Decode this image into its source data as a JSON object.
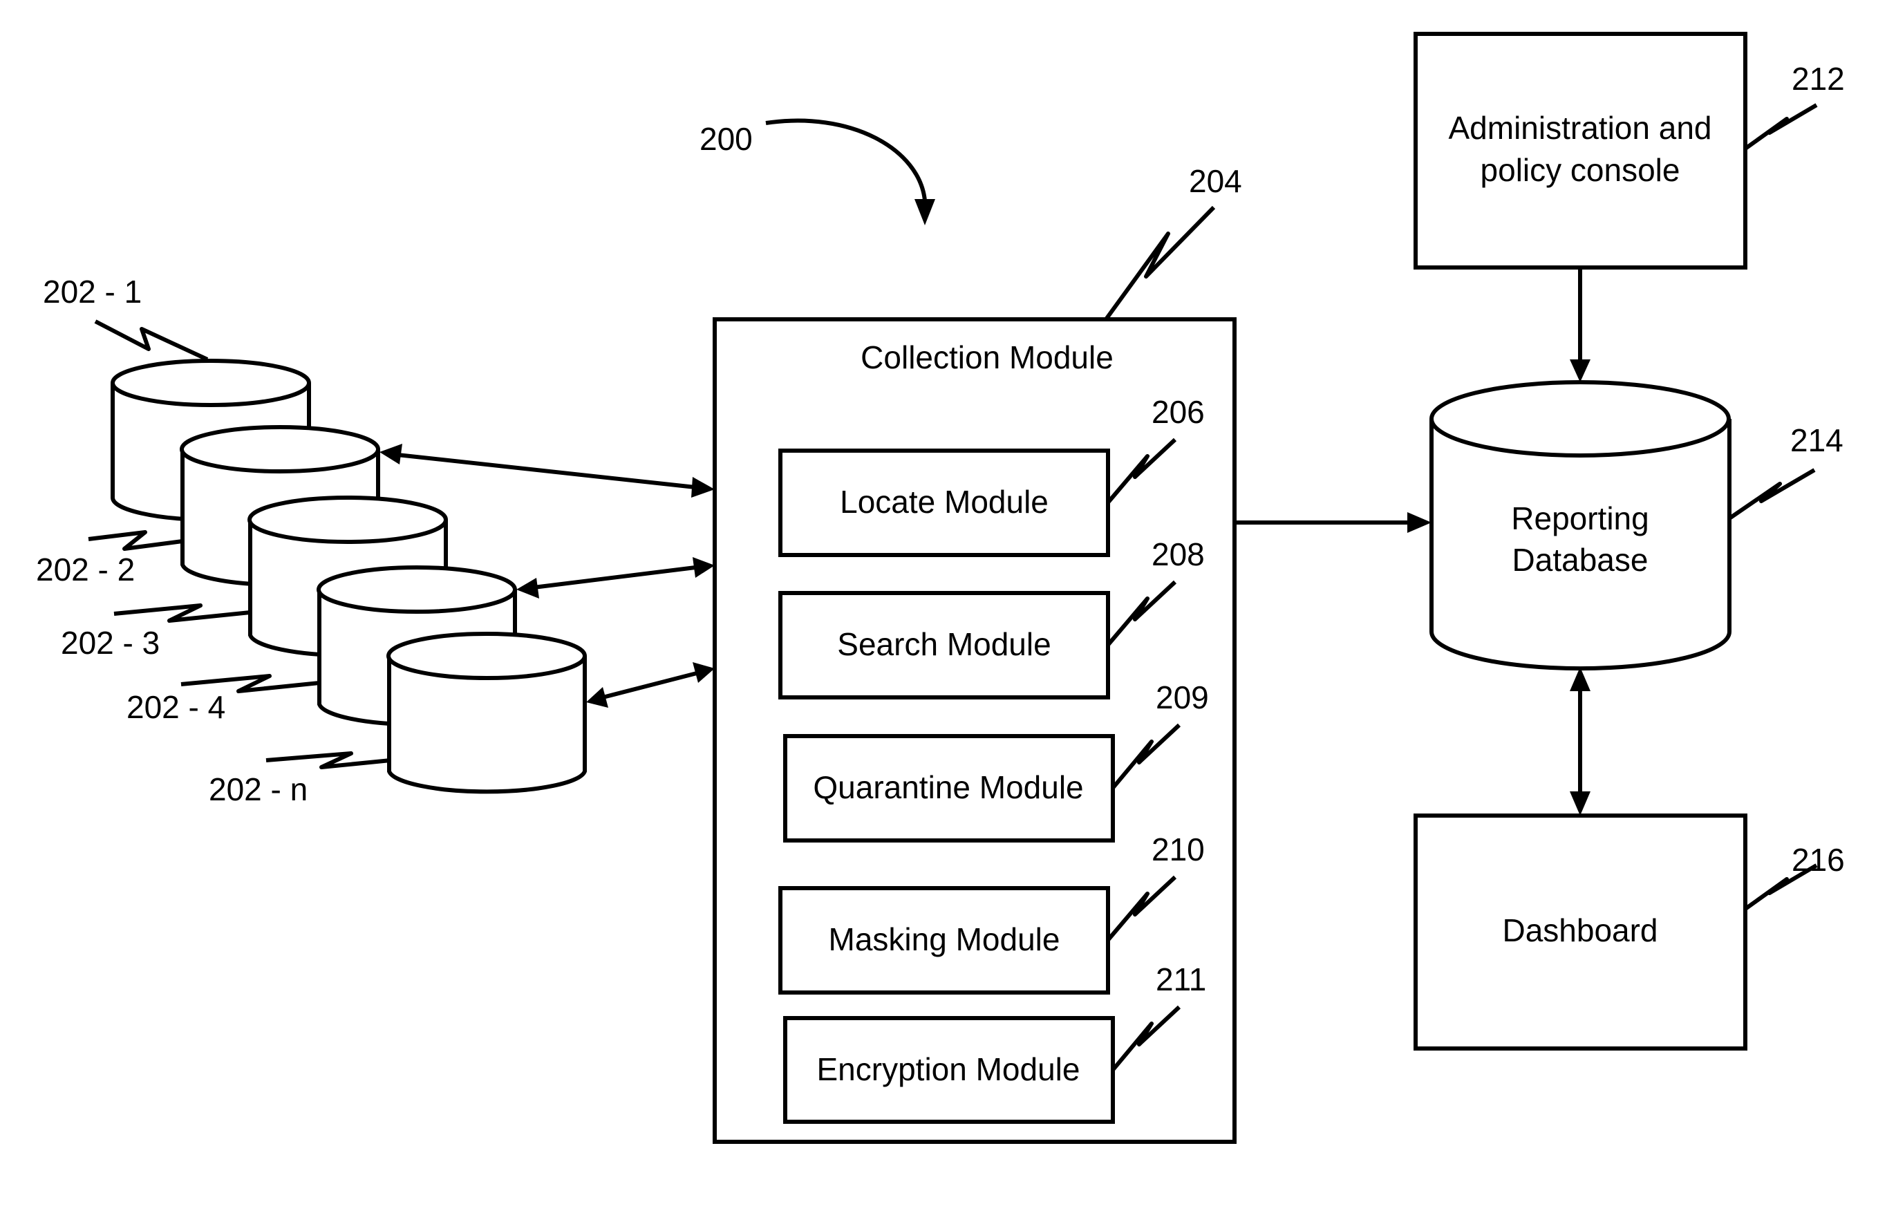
{
  "figure": {
    "reference": "200"
  },
  "data_sources": [
    {
      "ref": "202 - 1"
    },
    {
      "ref": "202 - 2"
    },
    {
      "ref": "202 - 3"
    },
    {
      "ref": "202 - 4"
    },
    {
      "ref": "202 - n"
    }
  ],
  "collection_module": {
    "title": "Collection Module",
    "ref": "204",
    "submodules": [
      {
        "label": "Locate Module",
        "ref": "206"
      },
      {
        "label": "Search Module",
        "ref": "208"
      },
      {
        "label": "Quarantine Module",
        "ref": "209"
      },
      {
        "label": "Masking Module",
        "ref": "210"
      },
      {
        "label": "Encryption Module",
        "ref": "211"
      }
    ]
  },
  "admin_console": {
    "line1": "Administration and",
    "line2": "policy console",
    "ref": "212"
  },
  "reporting_database": {
    "line1": "Reporting",
    "line2": "Database",
    "ref": "214"
  },
  "dashboard": {
    "label": "Dashboard",
    "ref": "216"
  },
  "colors": {
    "stroke": "#000000",
    "background": "#ffffff"
  }
}
